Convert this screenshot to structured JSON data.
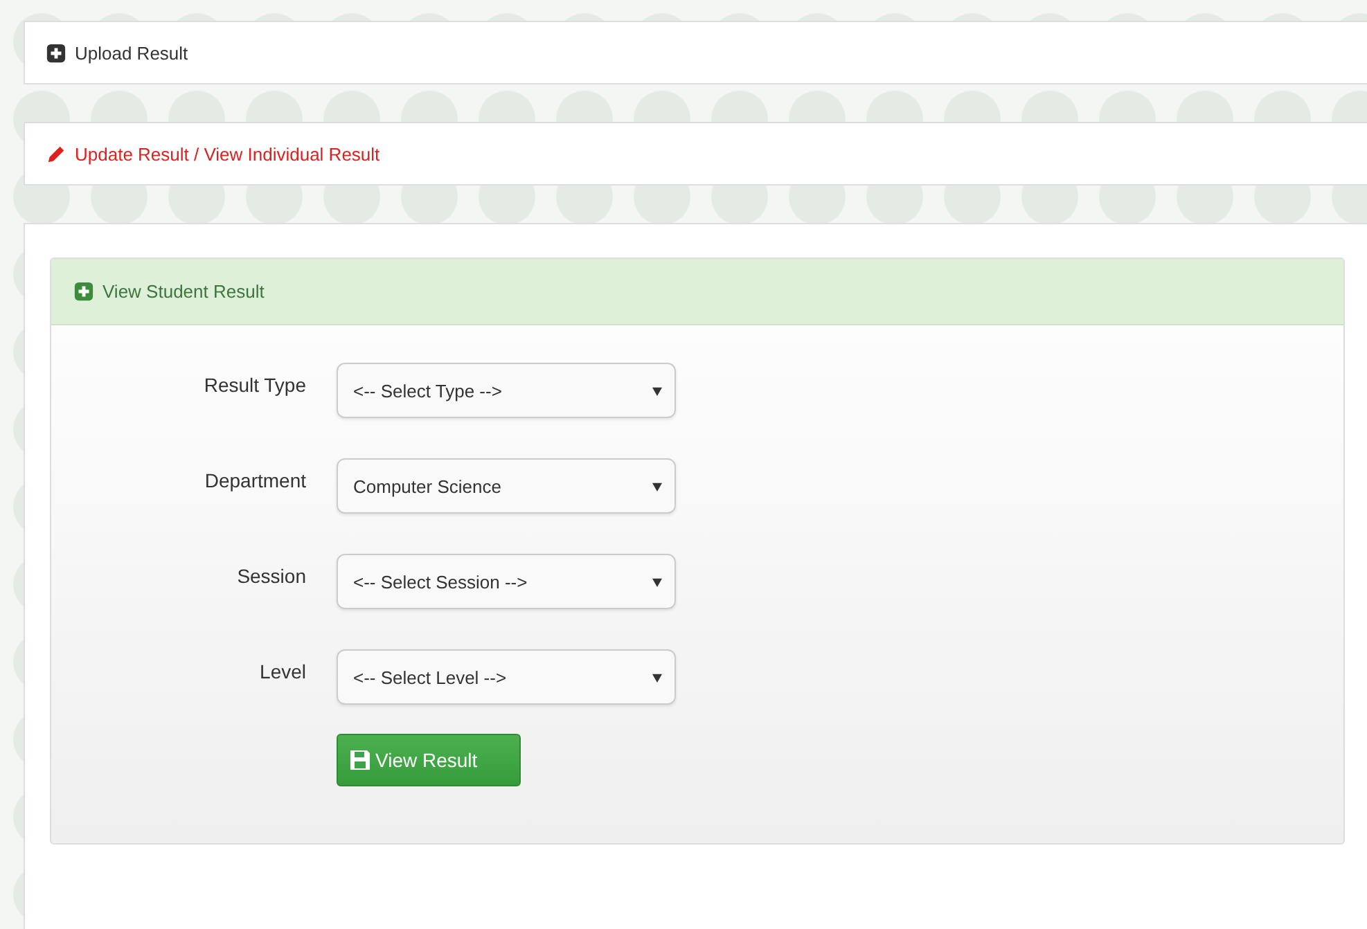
{
  "sections": [
    {
      "title": "Upload Result",
      "selected": false
    },
    {
      "title": "Update Result / View Individual Result",
      "selected": true
    }
  ],
  "panel": {
    "heading": "View Student Result",
    "fields": [
      {
        "label": "Result Type",
        "value": "<-- Select Type -->"
      },
      {
        "label": "Department",
        "value": "Computer Science"
      },
      {
        "label": "Session",
        "value": "<-- Select Session -->"
      },
      {
        "label": "Level",
        "value": "<-- Select Level -->"
      }
    ],
    "button": "View Result"
  }
}
